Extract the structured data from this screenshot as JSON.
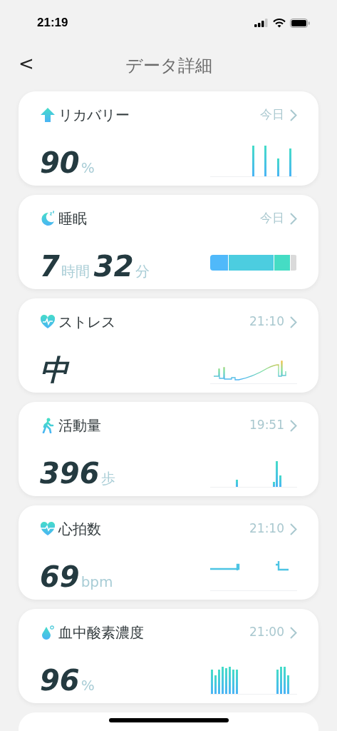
{
  "status_bar": {
    "time": "21:19"
  },
  "header": {
    "back": "<",
    "title": "データ詳細"
  },
  "cards": [
    {
      "title": "リカバリー",
      "meta": "今日",
      "kind": "bars",
      "value": [
        {
          "kind": "number",
          "text": "90"
        },
        {
          "kind": "unit",
          "text": "%"
        }
      ]
    },
    {
      "title": "睡眠",
      "meta": "今日",
      "kind": "stages",
      "value": [
        {
          "kind": "number",
          "text": "7"
        },
        {
          "kind": "unit",
          "text": "時間"
        },
        {
          "kind": "number",
          "text": "32"
        },
        {
          "kind": "unit",
          "text": "分"
        }
      ]
    },
    {
      "title": "ストレス",
      "meta": "21:10",
      "kind": "line",
      "value": [
        {
          "kind": "number",
          "text": "中"
        }
      ]
    },
    {
      "title": "活動量",
      "meta": "19:51",
      "kind": "steps",
      "value": [
        {
          "kind": "number",
          "text": "396"
        },
        {
          "kind": "unit",
          "text": "歩"
        }
      ]
    },
    {
      "title": "心拍数",
      "meta": "21:10",
      "kind": "heart",
      "value": [
        {
          "kind": "number",
          "text": "69"
        },
        {
          "kind": "unit",
          "text": "bpm"
        }
      ]
    },
    {
      "title": "血中酸素濃度",
      "meta": "21:00",
      "kind": "oxygen",
      "value": [
        {
          "kind": "number",
          "text": "96"
        },
        {
          "kind": "unit",
          "text": "%"
        }
      ]
    }
  ]
}
